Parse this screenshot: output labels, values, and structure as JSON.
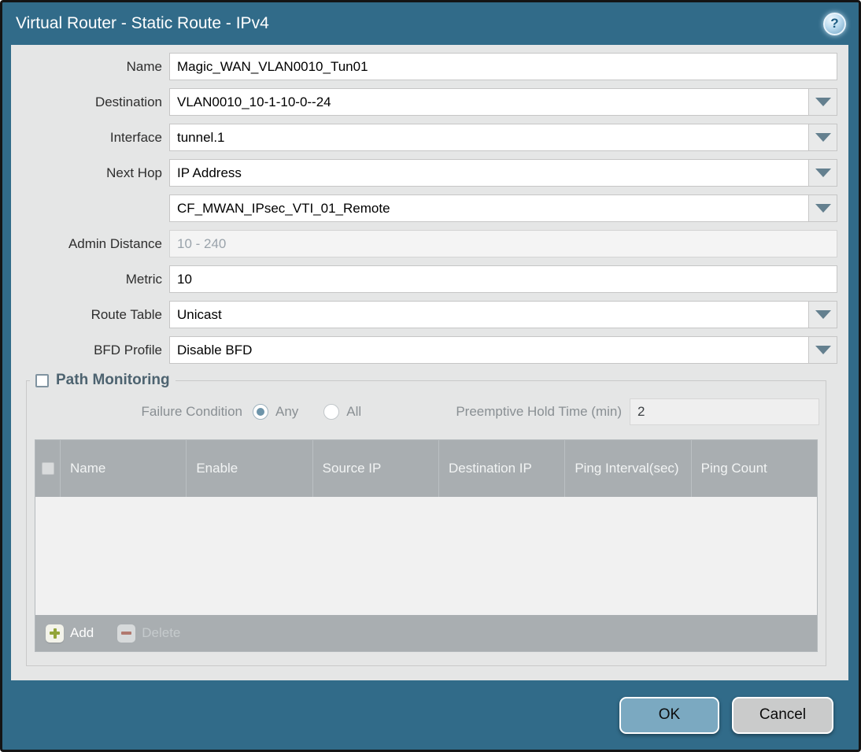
{
  "window": {
    "title": "Virtual Router - Static Route - IPv4"
  },
  "icons": {
    "help_glyph": "?"
  },
  "form": {
    "name": {
      "label": "Name",
      "value": "Magic_WAN_VLAN0010_Tun01"
    },
    "destination": {
      "label": "Destination",
      "value": "VLAN0010_10-1-10-0--24"
    },
    "interface": {
      "label": "Interface",
      "value": "tunnel.1"
    },
    "next_hop": {
      "label": "Next Hop",
      "value": "IP Address"
    },
    "next_hop_value": {
      "value": "CF_MWAN_IPsec_VTI_01_Remote"
    },
    "admin_distance": {
      "label": "Admin Distance",
      "placeholder": "10 - 240"
    },
    "metric": {
      "label": "Metric",
      "value": "10"
    },
    "route_table": {
      "label": "Route Table",
      "value": "Unicast"
    },
    "bfd_profile": {
      "label": "BFD Profile",
      "value": "Disable BFD"
    }
  },
  "path_monitoring": {
    "title": "Path Monitoring",
    "enabled": false,
    "failure_condition": {
      "label": "Failure Condition",
      "options": [
        {
          "label": "Any",
          "selected": true
        },
        {
          "label": "All",
          "selected": false
        }
      ]
    },
    "preemptive_hold_time": {
      "label": "Preemptive Hold Time (min)",
      "value": "2"
    },
    "table": {
      "columns": [
        "Name",
        "Enable",
        "Source IP",
        "Destination IP",
        "Ping Interval(sec)",
        "Ping Count"
      ],
      "rows": [],
      "add_label": "Add",
      "delete_label": "Delete"
    }
  },
  "footer": {
    "ok_label": "OK",
    "cancel_label": "Cancel"
  },
  "colors": {
    "frame_teal": "#316b89",
    "table_header_gray": "#a9aeb1",
    "ok_button_blue": "#7ba9c1",
    "add_plus_green": "#93a53a",
    "delete_minus_red": "#b1796f"
  }
}
